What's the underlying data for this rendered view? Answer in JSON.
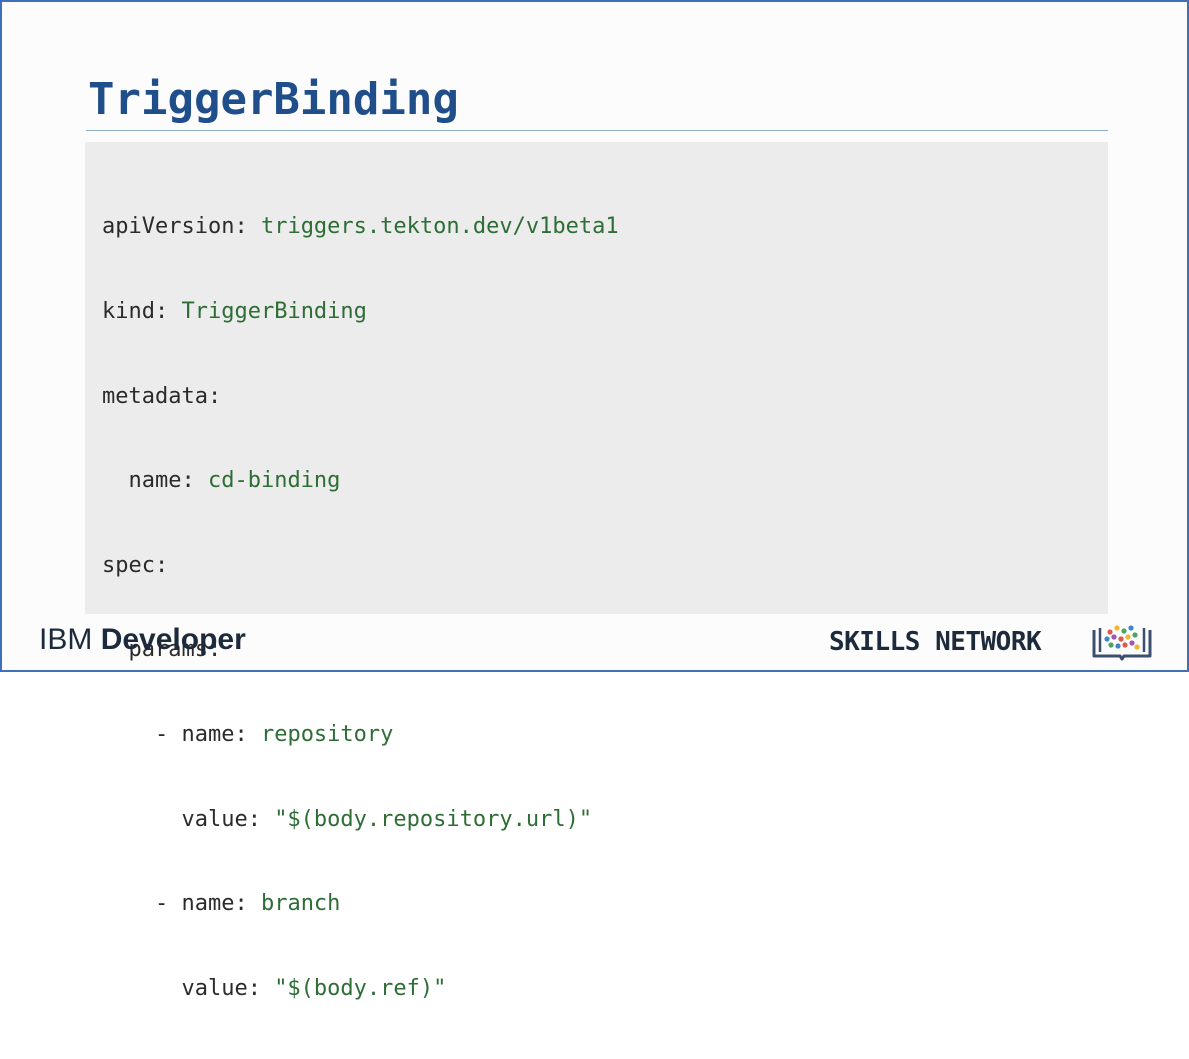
{
  "slide": {
    "title": "TriggerBinding",
    "code_lines": [
      {
        "key": "apiVersion: ",
        "value": "triggers.tekton.dev/v1beta1"
      },
      {
        "key": "kind: ",
        "value": "TriggerBinding"
      },
      {
        "key": "metadata:",
        "value": ""
      },
      {
        "key": "  name: ",
        "value": "cd-binding"
      },
      {
        "key": "spec:",
        "value": ""
      },
      {
        "key": "  params:",
        "value": ""
      },
      {
        "key": "    - name: ",
        "value": "repository"
      },
      {
        "key": "      value: ",
        "value": "\"$(body.repository.url)\""
      },
      {
        "key": "    - name: ",
        "value": "branch"
      },
      {
        "key": "      value: ",
        "value": "\"$(body.ref)\""
      }
    ]
  },
  "footer": {
    "left_brand_ibm": "IBM",
    "left_brand_developer": "Developer",
    "right_brand": "SKILLS NETWORK",
    "logo_icon": "book-network-icon"
  },
  "colors": {
    "title": "#1f4e8a",
    "code_value": "#2e6d35",
    "code_key": "#2b2b2b",
    "code_background": "#ececec",
    "frame_border": "#3f6fb6"
  }
}
